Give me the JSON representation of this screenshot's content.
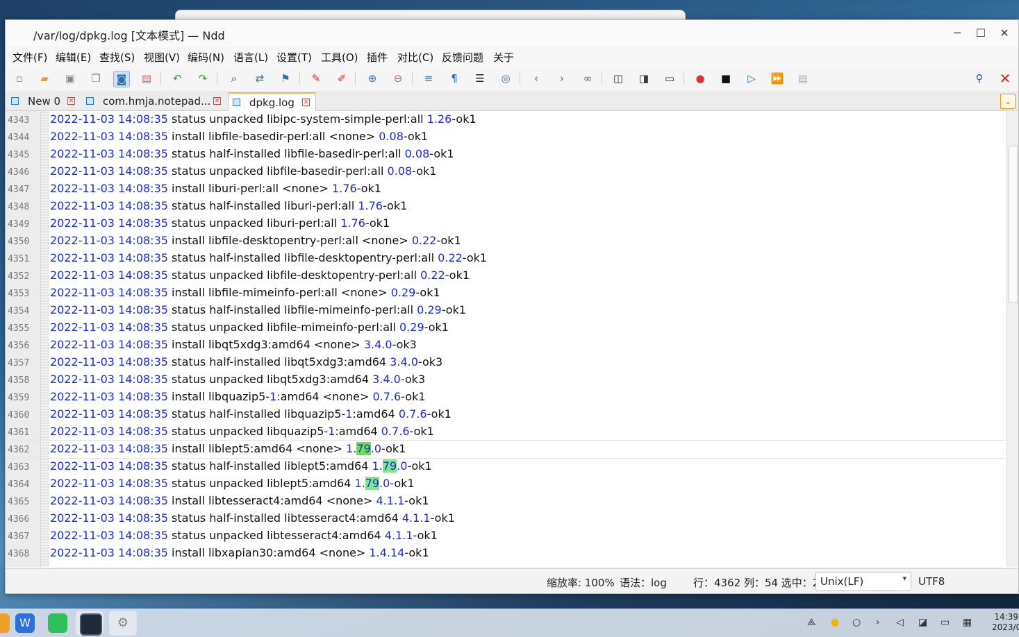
{
  "window": {
    "title": "/var/log/dpkg.log [文本模式] — Ndd",
    "minimize": "─",
    "maximize": "☐",
    "close": "✕"
  },
  "menu": [
    "文件(F)",
    "编辑(E)",
    "查找(S)",
    "视图(V)",
    "编码(N)",
    "语言(L)",
    "设置(T)",
    "工具(O)",
    "插件",
    "对比(C)",
    "反馈问题",
    "关于"
  ],
  "toolbar": {
    "icons": [
      "new-file-icon",
      "open-file-icon",
      "save-icon",
      "save-all-icon",
      "file-icon",
      "close-file-icon",
      "undo-icon",
      "redo-icon",
      "find-icon",
      "replace-icon",
      "bookmark-icon",
      "mark-icon",
      "clear-mark-icon",
      "zoom-in-icon",
      "zoom-out-icon",
      "word-wrap-icon",
      "show-symbols-icon",
      "indent-guide-icon",
      "target-icon",
      "prev-icon",
      "next-icon",
      "goto-icon",
      "compare-icon",
      "compare-dir-icon",
      "monitor-icon",
      "record-icon",
      "stop-icon",
      "play-icon",
      "play-multi-icon",
      "save-macro-icon"
    ],
    "pin_icon": "pin-icon",
    "close_icon": "close-icon",
    "accent_color": "#2a6fb7"
  },
  "tabs": [
    {
      "label": "New 0",
      "active": false
    },
    {
      "label": "com.hmja.notepad...",
      "active": false
    },
    {
      "label": "dpkg.log",
      "active": true
    }
  ],
  "editor": {
    "current_line": "4362",
    "lines": [
      {
        "n": "4343",
        "ts": "2022-11-03 14:08:35",
        "parts": [
          " status unpacked libipc-system-simple-perl:all ",
          {
            "v": "1.26"
          },
          "-ok1"
        ]
      },
      {
        "n": "4344",
        "ts": "2022-11-03 14:08:35",
        "parts": [
          " install libfile-basedir-perl:all <none> ",
          {
            "v": "0.08"
          },
          "-ok1"
        ]
      },
      {
        "n": "4345",
        "ts": "2022-11-03 14:08:35",
        "parts": [
          " status half-installed libfile-basedir-perl:all ",
          {
            "v": "0.08"
          },
          "-ok1"
        ]
      },
      {
        "n": "4346",
        "ts": "2022-11-03 14:08:35",
        "parts": [
          " status unpacked libfile-basedir-perl:all ",
          {
            "v": "0.08"
          },
          "-ok1"
        ]
      },
      {
        "n": "4347",
        "ts": "2022-11-03 14:08:35",
        "parts": [
          " install liburi-perl:all <none> ",
          {
            "v": "1.76"
          },
          "-ok1"
        ]
      },
      {
        "n": "4348",
        "ts": "2022-11-03 14:08:35",
        "parts": [
          " status half-installed liburi-perl:all ",
          {
            "v": "1.76"
          },
          "-ok1"
        ]
      },
      {
        "n": "4349",
        "ts": "2022-11-03 14:08:35",
        "parts": [
          " status unpacked liburi-perl:all ",
          {
            "v": "1.76"
          },
          "-ok1"
        ]
      },
      {
        "n": "4350",
        "ts": "2022-11-03 14:08:35",
        "parts": [
          " install libfile-desktopentry-perl:all <none> ",
          {
            "v": "0.22"
          },
          "-ok1"
        ]
      },
      {
        "n": "4351",
        "ts": "2022-11-03 14:08:35",
        "parts": [
          " status half-installed libfile-desktopentry-perl:all ",
          {
            "v": "0.22"
          },
          "-ok1"
        ]
      },
      {
        "n": "4352",
        "ts": "2022-11-03 14:08:35",
        "parts": [
          " status unpacked libfile-desktopentry-perl:all ",
          {
            "v": "0.22"
          },
          "-ok1"
        ]
      },
      {
        "n": "4353",
        "ts": "2022-11-03 14:08:35",
        "parts": [
          " install libfile-mimeinfo-perl:all <none> ",
          {
            "v": "0.29"
          },
          "-ok1"
        ]
      },
      {
        "n": "4354",
        "ts": "2022-11-03 14:08:35",
        "parts": [
          " status half-installed libfile-mimeinfo-perl:all ",
          {
            "v": "0.29"
          },
          "-ok1"
        ]
      },
      {
        "n": "4355",
        "ts": "2022-11-03 14:08:35",
        "parts": [
          " status unpacked libfile-mimeinfo-perl:all ",
          {
            "v": "0.29"
          },
          "-ok1"
        ]
      },
      {
        "n": "4356",
        "ts": "2022-11-03 14:08:35",
        "parts": [
          " install libqt5xdg3:amd64 <none> ",
          {
            "v": "3.4.0"
          },
          "-ok3"
        ]
      },
      {
        "n": "4357",
        "ts": "2022-11-03 14:08:35",
        "parts": [
          " status half-installed libqt5xdg3:amd64 ",
          {
            "v": "3.4.0"
          },
          "-ok3"
        ]
      },
      {
        "n": "4358",
        "ts": "2022-11-03 14:08:35",
        "parts": [
          " status unpacked libqt5xdg3:amd64 ",
          {
            "v": "3.4.0"
          },
          "-ok3"
        ]
      },
      {
        "n": "4359",
        "ts": "2022-11-03 14:08:35",
        "parts": [
          " install libquazip5-",
          {
            "v": "1"
          },
          ":amd64 <none> ",
          {
            "v": "0.7.6"
          },
          "-ok1"
        ]
      },
      {
        "n": "4360",
        "ts": "2022-11-03 14:08:35",
        "parts": [
          " status half-installed libquazip5-",
          {
            "v": "1"
          },
          ":amd64 ",
          {
            "v": "0.7.6"
          },
          "-ok1"
        ]
      },
      {
        "n": "4361",
        "ts": "2022-11-03 14:08:35",
        "parts": [
          " status unpacked libquazip5-",
          {
            "v": "1"
          },
          ":amd64 ",
          {
            "v": "0.7.6"
          },
          "-ok1"
        ]
      },
      {
        "n": "4362",
        "ts": "2022-11-03 14:08:35",
        "parts": [
          " install liblept5:amd64 <none> ",
          {
            "v": "1."
          },
          {
            "h": "79",
            "cur": true
          },
          {
            "v": ".0"
          },
          "-ok1"
        ]
      },
      {
        "n": "4363",
        "ts": "2022-11-03 14:08:35",
        "parts": [
          " status half-installed liblept5:amd64 ",
          {
            "v": "1."
          },
          {
            "h": "79"
          },
          {
            "v": ".0"
          },
          "-ok1"
        ]
      },
      {
        "n": "4364",
        "ts": "2022-11-03 14:08:35",
        "parts": [
          " status unpacked liblept5:amd64 ",
          {
            "v": "1."
          },
          {
            "h": "79"
          },
          {
            "v": ".0"
          },
          "-ok1"
        ]
      },
      {
        "n": "4365",
        "ts": "2022-11-03 14:08:35",
        "parts": [
          " install libtesseract4:amd64 <none> ",
          {
            "v": "4.1.1"
          },
          "-ok1"
        ]
      },
      {
        "n": "4366",
        "ts": "2022-11-03 14:08:35",
        "parts": [
          " status half-installed libtesseract4:amd64 ",
          {
            "v": "4.1.1"
          },
          "-ok1"
        ]
      },
      {
        "n": "4367",
        "ts": "2022-11-03 14:08:35",
        "parts": [
          " status unpacked libtesseract4:amd64 ",
          {
            "v": "4.1.1"
          },
          "-ok1"
        ]
      },
      {
        "n": "4368",
        "ts": "2022-11-03 14:08:35",
        "parts": [
          " install libxapian30:amd64 <none> ",
          {
            "v": "1.4.14"
          },
          "-ok1"
        ]
      }
    ],
    "number_color": "#1a2be0",
    "highlight_color": "#7ee787"
  },
  "status": {
    "zoom": "缩放率: 100%",
    "syntax": "语法：log",
    "position": "行：4362 列：54 选中：2",
    "eol": "Unix(LF)",
    "encoding": "UTF8"
  },
  "taskbar": {
    "apps": [
      "wps-icon",
      "chat-icon",
      "terminal-icon",
      "settings-icon"
    ],
    "tray": [
      "network-icon",
      "weather-icon",
      "search-icon",
      "expand-icon",
      "volume-icon",
      "devices-icon",
      "notification-icon",
      "keyboard-icon"
    ],
    "time": "14:39",
    "date": "2023/0"
  }
}
